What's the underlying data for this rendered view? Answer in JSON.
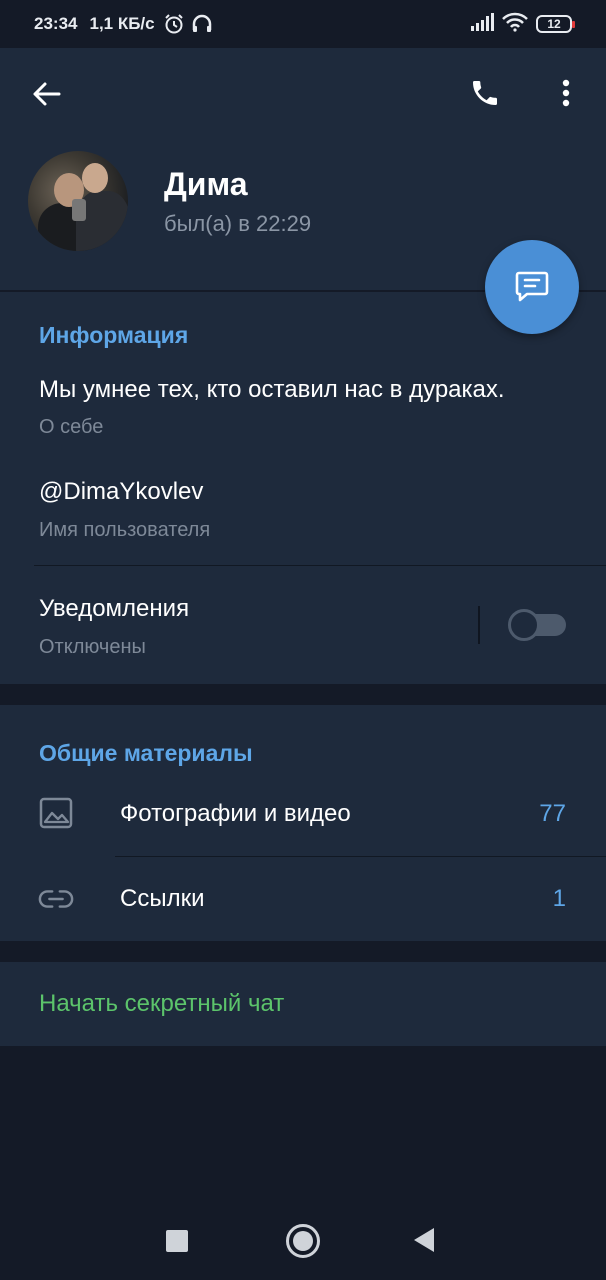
{
  "status_bar": {
    "time": "23:34",
    "network_speed": "1,1 КБ/с",
    "battery": "12",
    "icons": [
      "alarm-icon",
      "headphones-icon",
      "signal-icon",
      "wifi-icon",
      "battery-icon"
    ]
  },
  "header": {
    "name": "Дима",
    "last_seen": "был(а) в 22:29",
    "icons": [
      "back-arrow-icon",
      "phone-icon",
      "more-vert-icon",
      "message-icon"
    ]
  },
  "info": {
    "title": "Информация",
    "bio": "Мы умнее тех, кто оставил нас в дураках.",
    "bio_label": "О себе",
    "username": "@DimaYkovlev",
    "username_label": "Имя пользователя",
    "notifications": "Уведомления",
    "notifications_status": "Отключены",
    "notifications_enabled": false
  },
  "shared_media": {
    "title": "Общие материалы",
    "items": [
      {
        "label": "Фотографии и видео",
        "count": "77",
        "icon": "image-icon"
      },
      {
        "label": "Ссылки",
        "count": "1",
        "icon": "link-icon"
      }
    ]
  },
  "secret_chat": {
    "label": "Начать секретный чат"
  },
  "colors": {
    "background": "#141a27",
    "panel": "#1e2a3c",
    "accent": "#5ea6e7",
    "fab": "#4a8fd6",
    "secret": "#5cc46b"
  }
}
